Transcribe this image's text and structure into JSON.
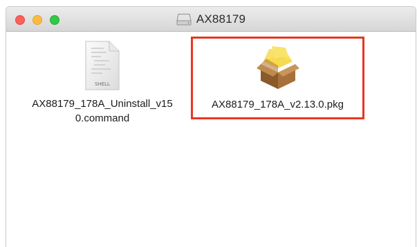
{
  "window": {
    "title": "AX88179",
    "title_icon": "drive-icon"
  },
  "files": [
    {
      "name_line1": "AX88179_178A_Uninstall_v15",
      "name_line2": "0.command",
      "icon": "shell-script-icon",
      "icon_label": "SHELL",
      "selected": false
    },
    {
      "name": "AX88179_178A_v2.13.0.pkg",
      "icon": "package-icon",
      "highlighted": true,
      "highlight_color": "#e8361f"
    }
  ]
}
